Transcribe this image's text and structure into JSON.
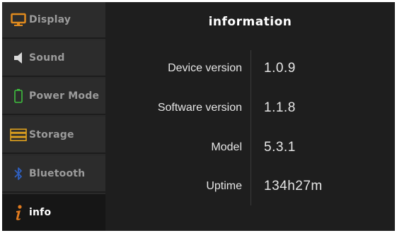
{
  "sidebar": {
    "items": [
      {
        "label": "Display",
        "icon": "monitor-icon",
        "color": "#e08a1e"
      },
      {
        "label": "Sound",
        "icon": "speaker-icon",
        "color": "#d9d9d9"
      },
      {
        "label": "Power Mode",
        "icon": "battery-icon",
        "color": "#3fbf3f"
      },
      {
        "label": "Storage",
        "icon": "storage-icon",
        "color": "#e0a21e"
      },
      {
        "label": "Bluetooth",
        "icon": "bluetooth-icon",
        "color": "#2f5fbf"
      },
      {
        "label": "info",
        "icon": "info-icon",
        "color": "#e07a1e",
        "active": true
      }
    ]
  },
  "main": {
    "title": "information",
    "rows": [
      {
        "label": "Device version",
        "value": "1.0.9"
      },
      {
        "label": "Software version",
        "value": "1.1.8"
      },
      {
        "label": "Model",
        "value": "5.3.1"
      },
      {
        "label": "Uptime",
        "value": "134h27m"
      }
    ]
  }
}
